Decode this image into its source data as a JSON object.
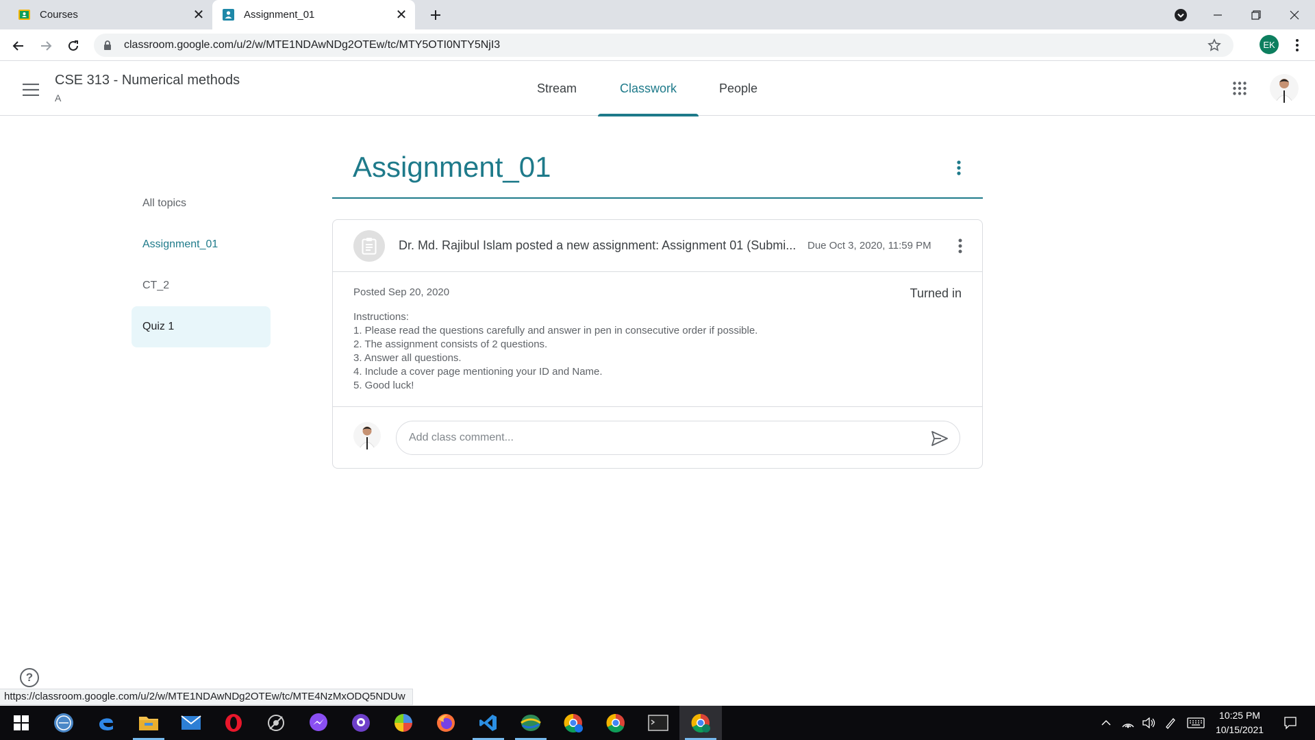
{
  "browser": {
    "tabs": [
      {
        "title": "Courses",
        "active": false
      },
      {
        "title": "Assignment_01",
        "active": true
      }
    ],
    "url": "classroom.google.com/u/2/w/MTE1NDAwNDg2OTEw/tc/MTY5OTI0NTY5NjI3",
    "profile_initials": "EK",
    "status_url": "https://classroom.google.com/u/2/w/MTE1NDAwNDg2OTEw/tc/MTE4NzMxODQ5NDUw"
  },
  "header": {
    "course_title": "CSE 313 - Numerical methods",
    "section": "A",
    "tabs": [
      "Stream",
      "Classwork",
      "People"
    ],
    "active_tab": "Classwork"
  },
  "topics": {
    "items": [
      "All topics",
      "Assignment_01",
      "CT_2",
      "Quiz 1"
    ],
    "current": "Assignment_01",
    "selected": "Quiz 1"
  },
  "topic_heading": "Assignment_01",
  "assignment": {
    "title": "Dr. Md. Rajibul Islam posted a new assignment: Assignment 01 (Submi...",
    "due": "Due Oct 3, 2020, 11:59 PM",
    "posted": "Posted Sep 20, 2020",
    "status": "Turned in",
    "instructions": [
      "Instructions:",
      "1. Please read the questions carefully and answer in pen in consecutive order if possible.",
      "2. The assignment consists of 2 questions.",
      "3. Answer all questions.",
      "4. Include a cover page mentioning your ID and Name.",
      "5. Good luck!"
    ],
    "comment_placeholder": "Add class comment..."
  },
  "help_glyph": "?",
  "taskbar": {
    "time": "10:25 PM",
    "date": "10/15/2021"
  },
  "colors": {
    "accent": "#1e7a8a",
    "selected_topic_bg": "#e8f6fa"
  }
}
